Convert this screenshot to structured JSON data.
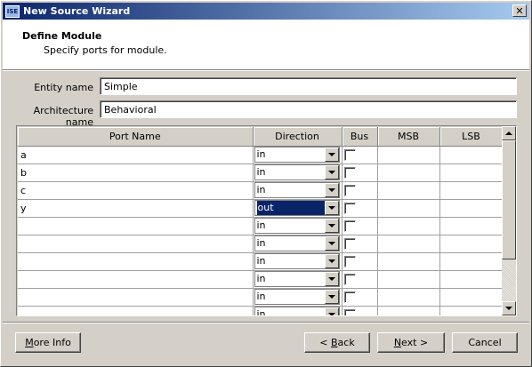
{
  "window": {
    "title": "New Source Wizard",
    "icon": "app-icon",
    "close_glyph": "✕"
  },
  "header": {
    "title": "Define Module",
    "subtitle": "Specify ports for module."
  },
  "form": {
    "entity_label": "Entity name",
    "entity_value": "Simple",
    "arch_label": "Architecture name",
    "arch_value": "Behavioral"
  },
  "grid": {
    "columns": [
      "Port Name",
      "Direction",
      "Bus",
      "MSB",
      "LSB"
    ],
    "rows": [
      {
        "name": "a",
        "direction": "in",
        "selected": false
      },
      {
        "name": "b",
        "direction": "in",
        "selected": false
      },
      {
        "name": "c",
        "direction": "in",
        "selected": false
      },
      {
        "name": "y",
        "direction": "out",
        "selected": true
      },
      {
        "name": "",
        "direction": "in",
        "selected": false
      },
      {
        "name": "",
        "direction": "in",
        "selected": false
      },
      {
        "name": "",
        "direction": "in",
        "selected": false
      },
      {
        "name": "",
        "direction": "in",
        "selected": false
      },
      {
        "name": "",
        "direction": "in",
        "selected": false
      },
      {
        "name": "",
        "direction": "in",
        "selected": false
      }
    ]
  },
  "buttons": {
    "more_info": {
      "mnemonic": "M",
      "rest": "ore Info"
    },
    "back": {
      "prefix": "< ",
      "mnemonic": "B",
      "rest": "ack"
    },
    "next": {
      "mnemonic": "N",
      "rest": "ext >"
    },
    "cancel": "Cancel"
  }
}
